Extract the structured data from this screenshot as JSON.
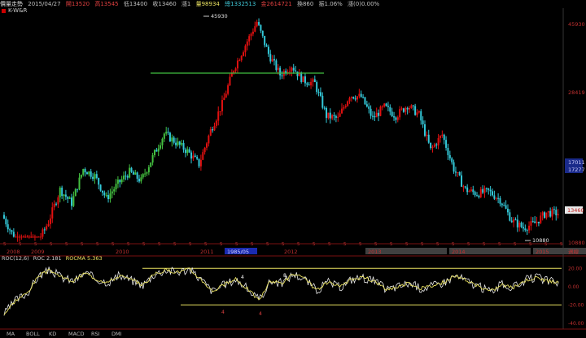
{
  "header": {
    "name": "價量走勢",
    "date": "2015/04/27",
    "open": "開13520",
    "high": "高13545",
    "low": "低13400",
    "close": "收13460",
    "change": "漲1",
    "volume": "量98934",
    "total": "總1332513",
    "amount": "金2614721",
    "field_a": "換860",
    "pct": "振1.06%",
    "status": "漲(0)0.00%"
  },
  "symbol_label": "K-W&R",
  "price_axis": {
    "labels": [
      "45930",
      "28419",
      "17011",
      "17277",
      "13460",
      "10880"
    ],
    "peak_label": "45930",
    "low_label": "10880",
    "current_label": "13460"
  },
  "x_axis": {
    "years": [
      "2008",
      "2009",
      "2010",
      "2011",
      "2012",
      "2013",
      "2014",
      "2015"
    ],
    "months_sample": "5",
    "selected_label": "1985/05",
    "right_label": "週線"
  },
  "roc": {
    "title": "ROC(12,6)",
    "value": "ROC 2.181",
    "ma": "ROCMA 5.363",
    "axis_labels": [
      "20.00",
      "0.00",
      "-20.00",
      "-40.00"
    ],
    "markers": [
      "4",
      "8",
      "4",
      "4"
    ]
  },
  "tabs": [
    "MA",
    "BOLL",
    "KD",
    "MACD",
    "RSI",
    "DMI"
  ],
  "colors": {
    "bg": "#000000",
    "up": "#e01010",
    "down": "#33c8d8",
    "green": "#44c040",
    "hline": "#40c040",
    "yellow": "#e8e060"
  },
  "price_series": [
    13200,
    9500,
    5800,
    8200,
    12000,
    17500,
    15200,
    21000,
    19800,
    16000,
    18500,
    20500,
    19000,
    23000,
    27000,
    25500,
    24000,
    21800,
    27500,
    32000,
    38000,
    42000,
    45930,
    40500,
    37000,
    38500,
    36000,
    35500,
    30000,
    29500,
    33500,
    33200,
    29600,
    31500,
    30000,
    31800,
    30200,
    24200,
    26800,
    21000,
    17500,
    16800,
    17200,
    15800,
    12300,
    11000,
    11800,
    13600,
    13460
  ],
  "roc_series": [
    -30,
    -15,
    -7,
    12,
    18,
    10,
    6,
    15,
    8,
    5,
    12,
    7,
    2,
    14,
    18,
    16,
    19,
    8,
    -5,
    2,
    8,
    -2,
    -15,
    6,
    4,
    14,
    8,
    -4,
    5,
    -1,
    8,
    10,
    6,
    -3,
    0,
    4,
    -2,
    1,
    5,
    12,
    6,
    0,
    -5,
    2,
    -1,
    7,
    10,
    6,
    4
  ]
}
